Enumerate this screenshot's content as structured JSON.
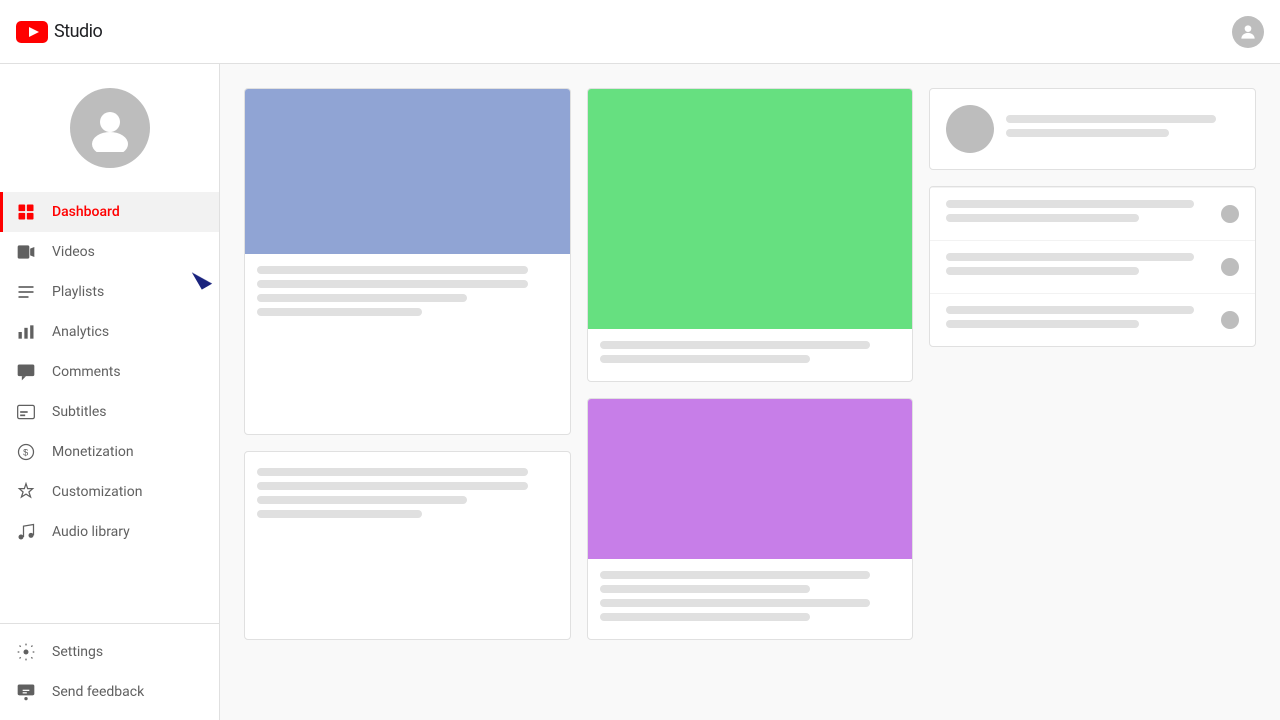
{
  "header": {
    "logo_text": "Studio",
    "user_tooltip": "Account"
  },
  "sidebar": {
    "nav_items": [
      {
        "id": "dashboard",
        "label": "Dashboard",
        "icon": "grid-icon",
        "active": true
      },
      {
        "id": "videos",
        "label": "Videos",
        "icon": "video-icon",
        "active": false
      },
      {
        "id": "playlists",
        "label": "Playlists",
        "icon": "playlist-icon",
        "active": false
      },
      {
        "id": "analytics",
        "label": "Analytics",
        "icon": "analytics-icon",
        "active": false
      },
      {
        "id": "comments",
        "label": "Comments",
        "icon": "comments-icon",
        "active": false
      },
      {
        "id": "subtitles",
        "label": "Subtitles",
        "icon": "subtitles-icon",
        "active": false
      },
      {
        "id": "monetization",
        "label": "Monetization",
        "icon": "monetization-icon",
        "active": false
      },
      {
        "id": "customization",
        "label": "Customization",
        "icon": "customization-icon",
        "active": false
      },
      {
        "id": "audio-library",
        "label": "Audio library",
        "icon": "audio-icon",
        "active": false
      }
    ],
    "bottom_items": [
      {
        "id": "settings",
        "label": "Settings",
        "icon": "settings-icon"
      },
      {
        "id": "send-feedback",
        "label": "Send feedback",
        "icon": "feedback-icon"
      }
    ]
  }
}
